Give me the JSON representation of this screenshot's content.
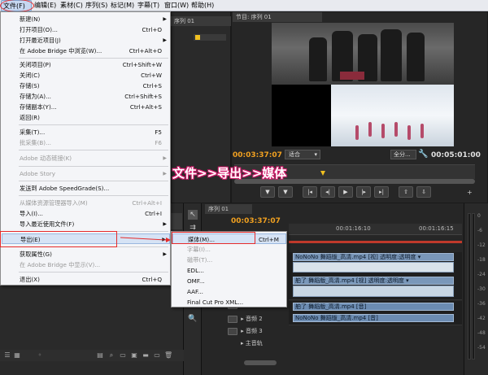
{
  "menubar": {
    "items": [
      "文件(F)",
      "编辑(E)",
      "素材(C)",
      "序列(S)",
      "标记(M)",
      "字幕(T)",
      "窗口(W)",
      "帮助(H)"
    ]
  },
  "file_menu": {
    "items": [
      {
        "label": "新建(N)",
        "shortcut": "",
        "submenu": true,
        "disabled": false
      },
      {
        "label": "打开项目(O)...",
        "shortcut": "Ctrl+O",
        "submenu": false,
        "disabled": false
      },
      {
        "label": "打开最近项目(J)",
        "shortcut": "",
        "submenu": true,
        "disabled": false
      },
      {
        "label": "在 Adobe Bridge 中浏览(W)...",
        "shortcut": "Ctrl+Alt+O",
        "submenu": false,
        "disabled": false
      },
      {
        "label": "关闭项目(P)",
        "shortcut": "Ctrl+Shift+W",
        "submenu": false,
        "disabled": false
      },
      {
        "label": "关闭(C)",
        "shortcut": "Ctrl+W",
        "submenu": false,
        "disabled": false
      },
      {
        "label": "存储(S)",
        "shortcut": "Ctrl+S",
        "submenu": false,
        "disabled": false
      },
      {
        "label": "存储为(A)...",
        "shortcut": "Ctrl+Shift+S",
        "submenu": false,
        "disabled": false
      },
      {
        "label": "存储副本(Y)...",
        "shortcut": "Ctrl+Alt+S",
        "submenu": false,
        "disabled": false
      },
      {
        "label": "返回(R)",
        "shortcut": "",
        "submenu": false,
        "disabled": false
      },
      {
        "label": "采集(T)...",
        "shortcut": "F5",
        "submenu": false,
        "disabled": false
      },
      {
        "label": "批采集(B)...",
        "shortcut": "F6",
        "submenu": false,
        "disabled": true
      },
      {
        "label": "Adobe 动态链接(K)",
        "shortcut": "",
        "submenu": true,
        "disabled": true
      },
      {
        "label": "Adobe Story",
        "shortcut": "",
        "submenu": true,
        "disabled": true
      },
      {
        "label": "发送到 Adobe SpeedGrade(S)...",
        "shortcut": "",
        "submenu": false,
        "disabled": false
      },
      {
        "label": "从媒体资源管理器导入(M)",
        "shortcut": "Ctrl+Alt+I",
        "submenu": false,
        "disabled": true
      },
      {
        "label": "导入(I)...",
        "shortcut": "Ctrl+I",
        "submenu": false,
        "disabled": false
      },
      {
        "label": "导入最近使用文件(F)",
        "shortcut": "",
        "submenu": true,
        "disabled": false
      },
      {
        "label": "导出(E)",
        "shortcut": "",
        "submenu": true,
        "disabled": false
      },
      {
        "label": "获取属性(G)",
        "shortcut": "",
        "submenu": true,
        "disabled": false
      },
      {
        "label": "在 Adobe Bridge 中显示(V)...",
        "shortcut": "",
        "submenu": false,
        "disabled": true
      },
      {
        "label": "退出(X)",
        "shortcut": "Ctrl+Q",
        "submenu": false,
        "disabled": false
      }
    ]
  },
  "export_submenu": {
    "items": [
      {
        "label": "媒体(M)...",
        "shortcut": "Ctrl+M",
        "disabled": false
      },
      {
        "label": "字幕(I)...",
        "shortcut": "",
        "disabled": true
      },
      {
        "label": "磁带(T)...",
        "shortcut": "",
        "disabled": true
      },
      {
        "label": "EDL...",
        "shortcut": "",
        "disabled": false
      },
      {
        "label": "OMF...",
        "shortcut": "",
        "disabled": false
      },
      {
        "label": "AAF...",
        "shortcut": "",
        "disabled": false
      },
      {
        "label": "Final Cut Pro XML...",
        "shortcut": "",
        "disabled": false
      }
    ]
  },
  "annotation": "文件>>导出>>媒体",
  "program_monitor": {
    "tab": "节目: 序列 01",
    "timecode": "00:03:37:07",
    "fit": "适合",
    "quality": "全分...",
    "duration": "00:05:01:00"
  },
  "project_panel": {
    "tab": "序列 01"
  },
  "timeline": {
    "tab": "序列 01",
    "timecode": "00:03:37:07",
    "ticks": [
      "00:01:16:10",
      "00:01:16:15"
    ],
    "clips": {
      "video_upper": "NoNoNo 舞蹈版_高清.mp4 [视] 透明度:透明度 ▾",
      "video_lower": "舶了 舞蹈版_高清.mp4 [视] 透明度:透明度 ▾",
      "audio_1": "舶了 舞蹈版_高清.mp4 [音]",
      "audio_2": "NoNoNo 舞蹈版_高清.mp4 [音]"
    },
    "tracks": {
      "audio_2": "音频 2",
      "audio_3": "音频 3",
      "master": "主音轨"
    }
  },
  "audio_meter": {
    "labels": [
      "0",
      "-6",
      "-12",
      "-18",
      "-24",
      "-30",
      "-36",
      "-42",
      "-48",
      "-54"
    ]
  }
}
